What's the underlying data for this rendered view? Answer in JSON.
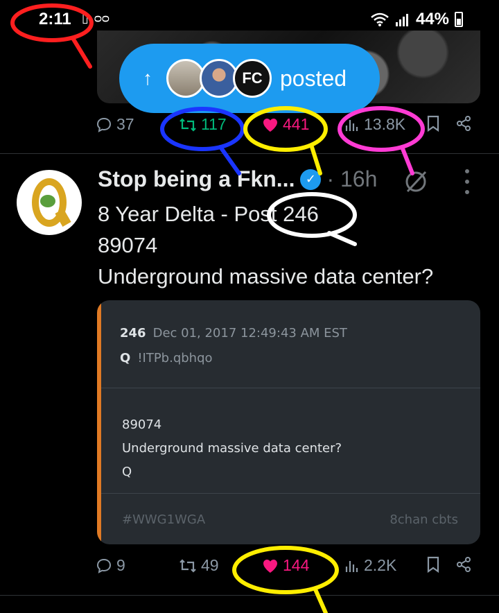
{
  "status_bar": {
    "time": "2:11",
    "battery": "44%"
  },
  "top_post": {
    "posted_pill": {
      "label": "posted",
      "avatar_badge": "FC"
    },
    "replies": "37",
    "reposts": "117",
    "likes": "441",
    "views": "13.8K"
  },
  "tweet": {
    "author_name": "Stop being a Fkn...",
    "timestamp": "16h",
    "lines": [
      "8 Year Delta - Post 246",
      "89074",
      "Underground massive data center?"
    ],
    "quote_card": {
      "post_number": "246",
      "date": "Dec 01, 2017 12:49:43 AM EST",
      "author": "Q",
      "tripcode": "!ITPb.qbhqo",
      "body": [
        "89074",
        "Underground massive data center?",
        "Q"
      ],
      "hashtag": "#WWG1WGA",
      "source": "8chan cbts"
    },
    "replies": "9",
    "reposts": "49",
    "likes": "144",
    "views": "2.2K"
  },
  "colors": {
    "accent": "#1d9bf0",
    "repost_active": "#00ba7c",
    "like_active": "#f91880",
    "card_accent": "#e07a24",
    "annotation_red": "#ff1f1f",
    "annotation_blue": "#1a35ff",
    "annotation_yellow": "#ffee00",
    "annotation_magenta": "#ff3bd4",
    "annotation_white": "#ffffff"
  },
  "icons": [
    "wifi-icon",
    "signal-icon",
    "battery-icon",
    "reply-icon",
    "repost-icon",
    "heart-icon",
    "views-icon",
    "bookmark-icon",
    "share-icon",
    "verified-icon",
    "grok-icon",
    "more-icon",
    "arrow-up-icon"
  ]
}
